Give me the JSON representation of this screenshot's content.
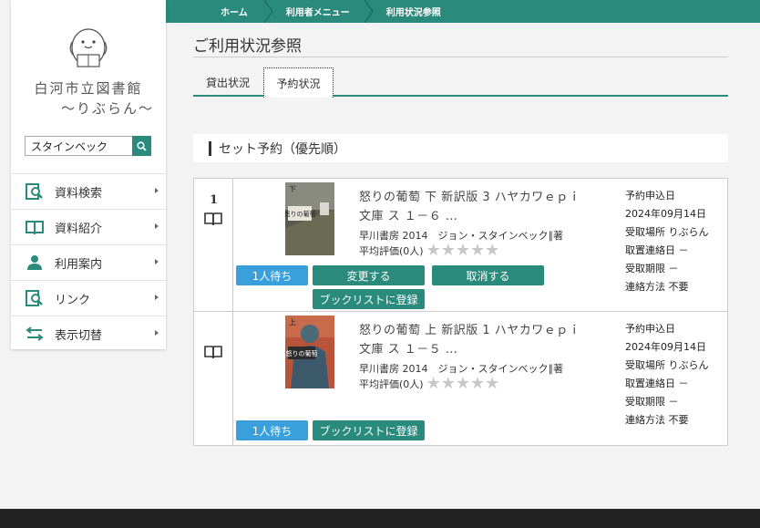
{
  "breadcrumb": [
    "ホーム",
    "利用者メニュー",
    "利用状況参照"
  ],
  "sidebar": {
    "library_name": "白河市立図書館",
    "library_nickname": "〜りぶらん〜",
    "search_value": "スタインベック",
    "items": [
      {
        "label": "資料検索",
        "icon": "search-doc-icon"
      },
      {
        "label": "資料紹介",
        "icon": "open-book-icon"
      },
      {
        "label": "利用案内",
        "icon": "person-icon"
      },
      {
        "label": "リンク",
        "icon": "search-doc-icon"
      },
      {
        "label": "表示切替",
        "icon": "swap-arrows-icon"
      }
    ]
  },
  "main": {
    "title": "ご利用状況参照",
    "tabs": [
      "貸出状況",
      "予約状況"
    ],
    "active_tab": "予約状況",
    "section_label": "セット予約（優先順）",
    "records": [
      {
        "number": "1",
        "cover_text": "怒りの葡萄",
        "cover_volume": "下",
        "title": "怒りの葡萄 下 新訳版 3 ハヤカワｅｐｉ文庫 ス １－６ …",
        "publisher_year_author": "早川書房 2014　ジョン・スタインベック∥著",
        "rating_text": "平均評価(0人)",
        "wait_label": "1人待ち",
        "buttons": {
          "change": "変更する",
          "cancel": "取消する",
          "booklist": "ブックリストに登録"
        },
        "info": [
          {
            "label": "予約申込日",
            "value": "2024年09月14日"
          },
          {
            "label": "受取場所",
            "value": "りぶらん"
          },
          {
            "label": "取置連絡日",
            "value": "－"
          },
          {
            "label": "受取期限",
            "value": "－"
          },
          {
            "label": "連絡方法",
            "value": "不要"
          }
        ]
      },
      {
        "number": "",
        "cover_text": "怒りの葡萄",
        "cover_volume": "上",
        "title": "怒りの葡萄 上 新訳版 1 ハヤカワｅｐｉ文庫 ス １－５ …",
        "publisher_year_author": "早川書房 2014　ジョン・スタインベック∥著",
        "rating_text": "平均評価(0人)",
        "wait_label": "1人待ち",
        "buttons": {
          "booklist": "ブックリストに登録"
        },
        "info": [
          {
            "label": "予約申込日",
            "value": "2024年09月14日"
          },
          {
            "label": "受取場所",
            "value": "りぶらん"
          },
          {
            "label": "取置連絡日",
            "value": "－"
          },
          {
            "label": "受取期限",
            "value": "－"
          },
          {
            "label": "連絡方法",
            "value": "不要"
          }
        ]
      }
    ]
  },
  "colors": {
    "accent": "#2a8a7c",
    "wait_badge": "#3aa0dc",
    "footer": "#222222"
  }
}
